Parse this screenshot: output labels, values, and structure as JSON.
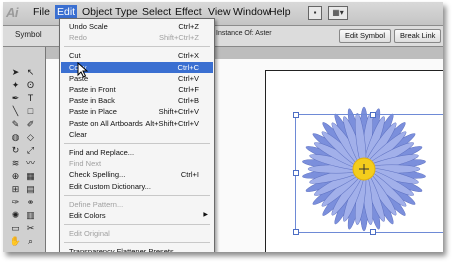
{
  "app": {
    "logo_text": "Ai"
  },
  "menubar": {
    "items": [
      "File",
      "Edit",
      "Object",
      "Type",
      "Select",
      "Effect",
      "View",
      "Window",
      "Help"
    ]
  },
  "controlbar": {
    "symbol_label": "Symbol",
    "instance_of": "Instance Of:  Aster",
    "edit_symbol": "Edit Symbol",
    "break_link": "Break Link"
  },
  "edit_menu": {
    "groups": [
      [
        {
          "label": "Undo Scale",
          "shortcut": "Ctrl+Z",
          "disabled": false
        },
        {
          "label": "Redo",
          "shortcut": "Shift+Ctrl+Z",
          "disabled": true
        }
      ],
      [
        {
          "label": "Cut",
          "shortcut": "Ctrl+X",
          "disabled": false
        },
        {
          "label": "Copy",
          "shortcut": "Ctrl+C",
          "disabled": false,
          "highlighted": true
        },
        {
          "label": "Paste",
          "shortcut": "Ctrl+V",
          "disabled": false
        },
        {
          "label": "Paste in Front",
          "shortcut": "Ctrl+F",
          "disabled": false
        },
        {
          "label": "Paste in Back",
          "shortcut": "Ctrl+B",
          "disabled": false
        },
        {
          "label": "Paste in Place",
          "shortcut": "Shift+Ctrl+V",
          "disabled": false
        },
        {
          "label": "Paste on All Artboards",
          "shortcut": "Alt+Shift+Ctrl+V",
          "disabled": false
        },
        {
          "label": "Clear",
          "shortcut": "",
          "disabled": false
        }
      ],
      [
        {
          "label": "Find and Replace...",
          "shortcut": "",
          "disabled": false
        },
        {
          "label": "Find Next",
          "shortcut": "",
          "disabled": true
        },
        {
          "label": "Check Spelling...",
          "shortcut": "Ctrl+I",
          "disabled": false
        },
        {
          "label": "Edit Custom Dictionary...",
          "shortcut": "",
          "disabled": false
        }
      ],
      [
        {
          "label": "Define Pattern...",
          "shortcut": "",
          "disabled": true
        },
        {
          "label": "Edit Colors",
          "shortcut": "",
          "disabled": false,
          "submenu": true
        }
      ],
      [
        {
          "label": "Edit Original",
          "shortcut": "",
          "disabled": true
        }
      ],
      [
        {
          "label": "Transparency Flattener Presets...",
          "shortcut": "",
          "disabled": false
        }
      ]
    ]
  },
  "colors": {
    "menu_highlight": "#3a6fd1",
    "petal": "#7b8fdc",
    "petal_light": "#a2b0ea",
    "center": "#f4cd1c",
    "selection": "#6e8ad6"
  },
  "icons": {
    "tools": [
      "selection-tool-icon",
      "direct-selection-tool-icon",
      "magic-wand-icon",
      "lasso-icon",
      "pen-tool-icon",
      "type-tool-icon",
      "line-tool-icon",
      "rectangle-tool-icon",
      "paintbrush-icon",
      "pencil-icon",
      "blob-brush-icon",
      "eraser-icon",
      "rotate-tool-icon",
      "scale-tool-icon",
      "width-tool-icon",
      "warp-tool-icon",
      "shape-builder-icon",
      "perspective-grid-icon",
      "mesh-tool-icon",
      "gradient-tool-icon",
      "eyedropper-icon",
      "blend-tool-icon",
      "symbol-sprayer-icon",
      "graph-tool-icon",
      "artboard-tool-icon",
      "slice-tool-icon",
      "hand-tool-icon",
      "zoom-tool-icon"
    ]
  }
}
